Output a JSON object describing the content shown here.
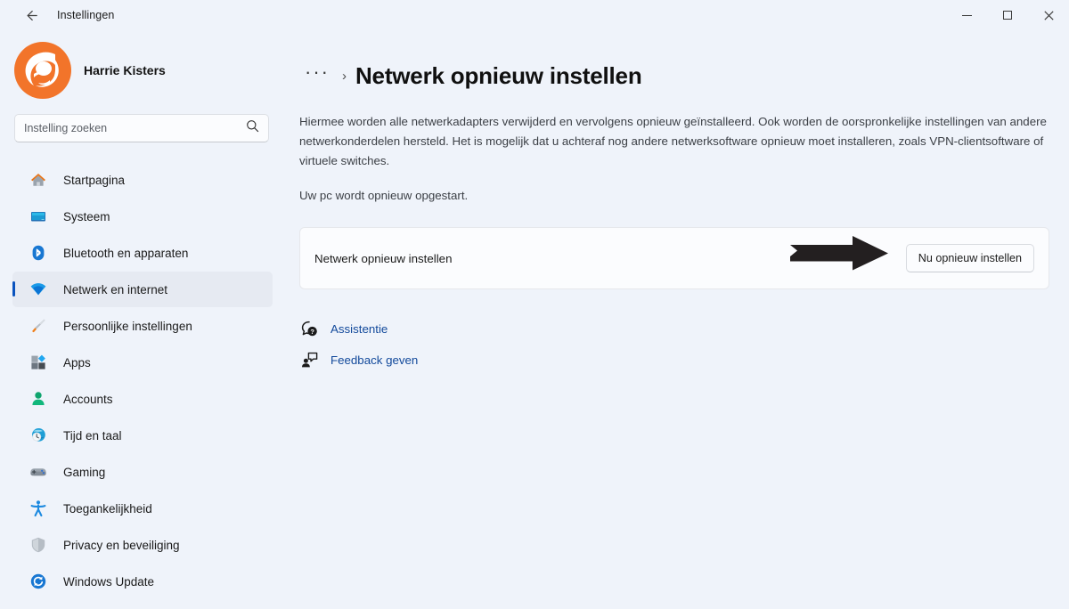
{
  "window": {
    "app_title": "Instellingen",
    "back_icon": "arrow-left-icon",
    "controls": {
      "minimize": "minimize-icon",
      "maximize": "maximize-icon",
      "close": "close-icon"
    }
  },
  "sidebar": {
    "profile": {
      "name": "Harrie Kisters",
      "avatar_icon": "user-avatar",
      "avatar_color": "#f2742a"
    },
    "search": {
      "placeholder": "Instelling zoeken",
      "value": "",
      "icon": "search-icon"
    },
    "selected_index": 3,
    "accent_color": "#0a53be",
    "selected_bg": "#e6eaf2",
    "items": [
      {
        "label": "Startpagina",
        "icon": "home-icon"
      },
      {
        "label": "Systeem",
        "icon": "monitor-icon"
      },
      {
        "label": "Bluetooth en apparaten",
        "icon": "bluetooth-icon"
      },
      {
        "label": "Netwerk en internet",
        "icon": "wifi-icon"
      },
      {
        "label": "Persoonlijke instellingen",
        "icon": "paintbrush-icon"
      },
      {
        "label": "Apps",
        "icon": "apps-icon"
      },
      {
        "label": "Accounts",
        "icon": "person-icon"
      },
      {
        "label": "Tijd en taal",
        "icon": "clock-globe-icon"
      },
      {
        "label": "Gaming",
        "icon": "gamepad-icon"
      },
      {
        "label": "Toegankelijkheid",
        "icon": "accessibility-icon"
      },
      {
        "label": "Privacy en beveiliging",
        "icon": "shield-icon"
      },
      {
        "label": "Windows Update",
        "icon": "refresh-icon"
      }
    ]
  },
  "main": {
    "breadcrumb": {
      "overflow": "···",
      "separator": "›"
    },
    "title": "Netwerk opnieuw instellen",
    "description": "Hiermee worden alle netwerkadapters verwijderd en vervolgens opnieuw geïnstalleerd. Ook worden de oorspronkelijke instellingen van andere netwerkonderdelen hersteld. Het is mogelijk dat u achteraf nog andere netwerksoftware opnieuw moet installeren, zoals VPN-clientsoftware of virtuele switches.",
    "note": "Uw pc wordt opnieuw opgestart.",
    "card": {
      "label": "Netwerk opnieuw instellen",
      "button_label": "Nu opnieuw instellen",
      "annotation": "black-arrow-pointing-right",
      "annotation_color": "#231f20"
    },
    "links": [
      {
        "label": "Assistentie",
        "icon": "help-question-icon",
        "color": "#12499b"
      },
      {
        "label": "Feedback geven",
        "icon": "feedback-person-icon",
        "color": "#12499b"
      }
    ]
  }
}
